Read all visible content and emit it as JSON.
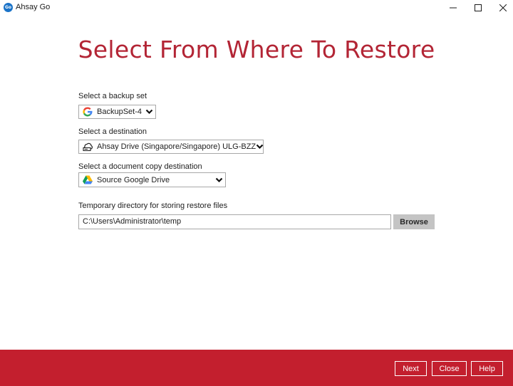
{
  "window": {
    "app_title": "Ahsay Go",
    "app_icon_text": "Go"
  },
  "page_title": "Select From Where To Restore",
  "backup_set": {
    "label": "Select a backup set",
    "value": "BackupSet-4",
    "icon": "google-g-icon"
  },
  "destination": {
    "label": "Select a destination",
    "value": "Ahsay Drive (Singapore/Singapore) ULG-BZZ",
    "icon": "cloud-drive-icon"
  },
  "doc_copy_destination": {
    "label": "Select a document copy destination",
    "value": "Source Google Drive",
    "icon": "google-drive-icon"
  },
  "temp_dir": {
    "label": "Temporary directory for storing restore files",
    "value": "C:\\Users\\Administrator\\temp",
    "browse_label": "Browse"
  },
  "footer": {
    "next_label": "Next",
    "close_label": "Close",
    "help_label": "Help"
  },
  "colors": {
    "accent": "#c31f2e",
    "title": "#b32535",
    "browse_bg": "#c4c4c4"
  }
}
